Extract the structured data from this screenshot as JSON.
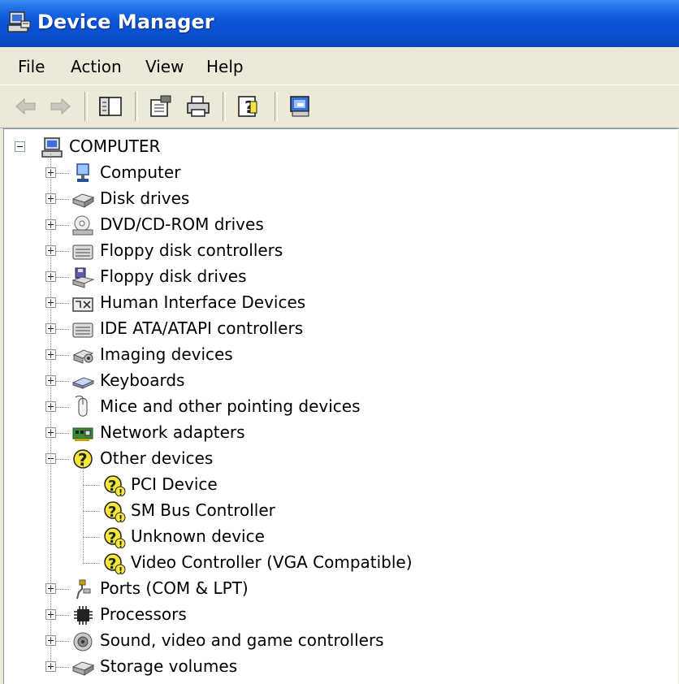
{
  "window": {
    "title": "Device Manager"
  },
  "menu": [
    "File",
    "Action",
    "View",
    "Help"
  ],
  "toolbar": [
    {
      "name": "back-button",
      "icon": "back-arrow-icon"
    },
    {
      "name": "forward-button",
      "icon": "forward-arrow-icon"
    },
    {
      "name": "show-hide-console-tree-button",
      "icon": "console-tree-icon"
    },
    {
      "name": "properties-button",
      "icon": "properties-icon"
    },
    {
      "name": "print-button",
      "icon": "printer-icon"
    },
    {
      "name": "help-button",
      "icon": "help-icon"
    },
    {
      "name": "scan-hardware-button",
      "icon": "scan-hardware-icon"
    }
  ],
  "tree": {
    "root": "COMPUTER",
    "categories": [
      {
        "label": "Computer",
        "icon": "computer-icon",
        "expanded": false
      },
      {
        "label": "Disk drives",
        "icon": "disk-drive-icon",
        "expanded": false
      },
      {
        "label": "DVD/CD-ROM drives",
        "icon": "cdrom-icon",
        "expanded": false
      },
      {
        "label": "Floppy disk controllers",
        "icon": "controller-icon",
        "expanded": false
      },
      {
        "label": "Floppy disk drives",
        "icon": "floppy-icon",
        "expanded": false
      },
      {
        "label": "Human Interface Devices",
        "icon": "hid-icon",
        "expanded": false
      },
      {
        "label": "IDE ATA/ATAPI controllers",
        "icon": "controller-icon",
        "expanded": false
      },
      {
        "label": "Imaging devices",
        "icon": "camera-icon",
        "expanded": false
      },
      {
        "label": "Keyboards",
        "icon": "keyboard-icon",
        "expanded": false
      },
      {
        "label": "Mice and other pointing devices",
        "icon": "mouse-icon",
        "expanded": false
      },
      {
        "label": "Network adapters",
        "icon": "network-card-icon",
        "expanded": false
      },
      {
        "label": "Other devices",
        "icon": "unknown-device-icon",
        "expanded": true,
        "children": [
          {
            "label": "PCI Device",
            "icon": "unknown-device-warning-icon"
          },
          {
            "label": "SM Bus Controller",
            "icon": "unknown-device-warning-icon"
          },
          {
            "label": "Unknown device",
            "icon": "unknown-device-warning-icon"
          },
          {
            "label": "Video Controller (VGA Compatible)",
            "icon": "unknown-device-warning-icon"
          }
        ]
      },
      {
        "label": "Ports (COM & LPT)",
        "icon": "port-icon",
        "expanded": false
      },
      {
        "label": "Processors",
        "icon": "processor-icon",
        "expanded": false
      },
      {
        "label": "Sound, video and game controllers",
        "icon": "speaker-icon",
        "expanded": false
      },
      {
        "label": "Storage volumes",
        "icon": "disk-drive-icon",
        "expanded": false
      }
    ]
  }
}
